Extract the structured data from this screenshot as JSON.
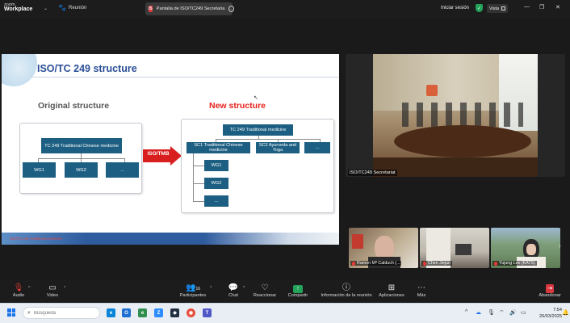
{
  "topbar": {
    "logo_line1": "zoom",
    "logo_line2": "Workplace",
    "meeting_label": "Reunión",
    "share_badge": "IS",
    "share_title": "Pantalla de ISO/TC249 Secretaria",
    "signin": "Iniciar sesión",
    "view_label": "Vista"
  },
  "slide": {
    "title": "ISO/TC 249 structure",
    "original_title": "Original structure",
    "new_title": "New structure",
    "arrow_label": "ISO/TMB",
    "original": {
      "top": "TC 249 Traditional Chinese medicine",
      "children": [
        "WG1",
        "WG2",
        "..."
      ]
    },
    "new": {
      "top": "TC 249 Traditional medicine",
      "subcommittees": [
        "SC1 Traditional Chinese medicine",
        "SC2 Ayurveda and Yoga",
        "..."
      ],
      "working_groups": [
        "WG1",
        "WG2",
        "..."
      ]
    },
    "footer": "ISO/TC 249 Traditional medicine"
  },
  "video": {
    "main_name": "ISO/TC249 Secretariat",
    "participants": [
      {
        "name": "Ramon Mª Calduch (..."
      },
      {
        "name": "Chen Jiejun"
      },
      {
        "name": "Yujung Lee (KATS)"
      }
    ]
  },
  "toolbar": {
    "audio": "Audio",
    "video": "Video",
    "participants": "Participantes",
    "participants_count": "16",
    "chat": "Chat",
    "reactions": "Reaccionar",
    "share": "Compartir",
    "info": "Información de la reunión",
    "apps": "Aplicaciones",
    "more": "Más",
    "leave": "Abandonar"
  },
  "taskbar": {
    "search_placeholder": "Búsqueda",
    "time": "7:54",
    "date": "26/03/2025"
  },
  "colors": {
    "slide_title": "#2a4e96",
    "new_title": "#e8211a",
    "box": "#1d5f82",
    "share_green": "#23a35a",
    "leave_red": "#d9363e"
  }
}
